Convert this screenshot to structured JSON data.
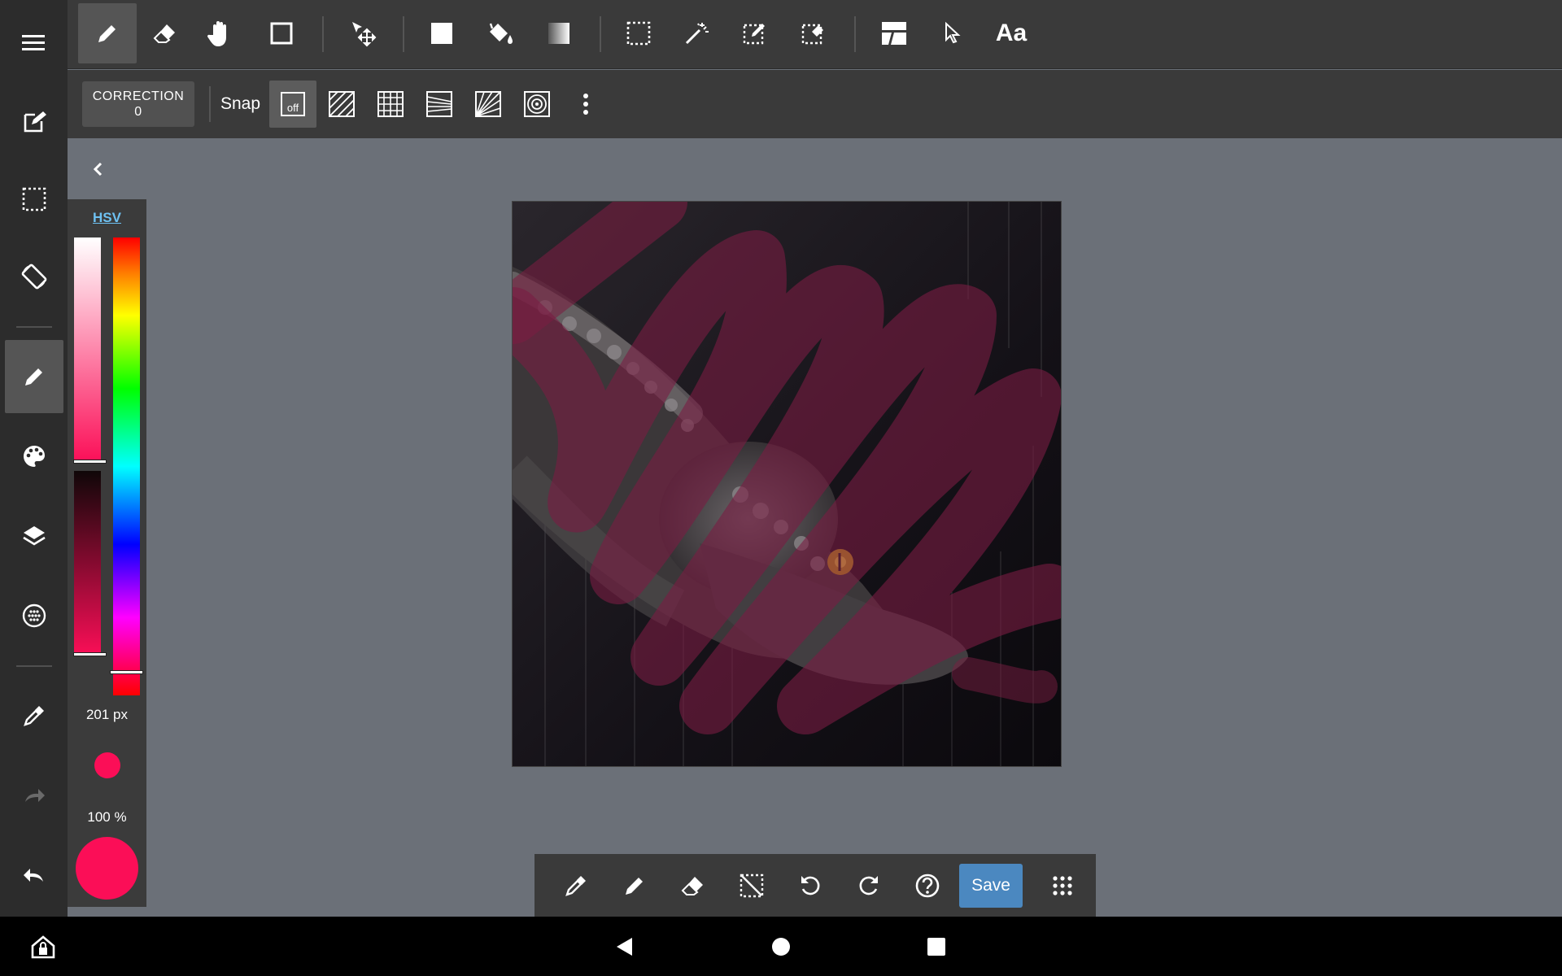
{
  "toolbar": {
    "text_tool_label": "Aa"
  },
  "sub_toolbar": {
    "correction_label": "CORRECTION",
    "correction_value": "0",
    "snap_label": "Snap",
    "snap_off_label": "off"
  },
  "color_panel": {
    "mode_label": "HSV",
    "brush_size": "201 px",
    "opacity": "100 %",
    "current_color": "#fb0e57",
    "saturation_level": 0.98,
    "value_level": 0.97,
    "hue_level": 0.95
  },
  "bottom_toolbar": {
    "save_label": "Save"
  },
  "colors": {
    "accent": "#4b88c0",
    "toolbar_bg": "#3a3a3a",
    "workspace_bg": "#6b7078",
    "hsv_link": "#6ec1f2"
  },
  "icons": {
    "left_rail": [
      "menu-icon",
      "edit-document-icon",
      "selection-icon",
      "rotate-screen-icon",
      "pen-icon",
      "palette-icon",
      "layers-icon",
      "materials-icon",
      "eyedropper-icon",
      "redo-icon",
      "undo-icon"
    ],
    "top_toolbar": [
      "pen-icon",
      "eraser-icon",
      "hand-icon",
      "rectangle-icon",
      "move-icon",
      "fill-rect-icon",
      "bucket-icon",
      "gradient-icon",
      "select-rect-icon",
      "magic-wand-icon",
      "select-pen-icon",
      "select-eraser-icon",
      "panel-layout-icon",
      "pointer-icon",
      "text-icon"
    ],
    "bottom_toolbar": [
      "eyedropper-icon",
      "pen-icon",
      "eraser-icon",
      "deselect-icon",
      "undo-icon",
      "redo-icon",
      "help-icon",
      "grid-menu-icon"
    ]
  }
}
